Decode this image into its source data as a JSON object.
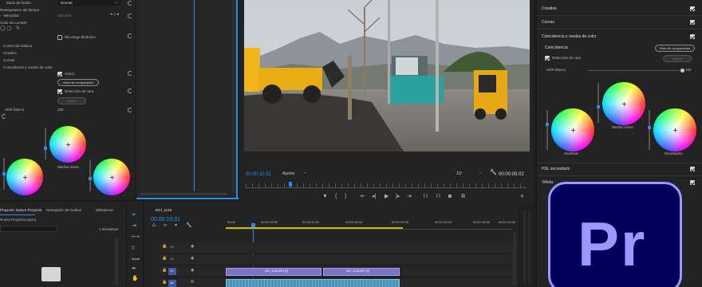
{
  "effect_controls": {
    "blend_mode_label": "Modo de fusión",
    "blend_mode_value": "Normal",
    "time_remap_label": "Reasignación del tiempo",
    "speed_label": "Velocidad",
    "speed_value": "100,00%",
    "lumetri_label": "Color de Lumetri",
    "hdr_range_label": "Alto rango dinámico",
    "basic_correction": "Corrección básica",
    "creative": "Creativo",
    "curves": "Curvas",
    "color_wheels_match": "Coincidencia y ruedas de color",
    "active_label": "Activo",
    "compare_view_button": "Vista de comparación",
    "face_detect_label": "Detección de cara",
    "apply_button": "Aplicar",
    "hdr_white_label": "HDR blanco",
    "hdr_white_value": "100",
    "midtones_label": "Medios tonos"
  },
  "program_monitor": {
    "timecode": "00:00:10:31",
    "fit_label": "Ajustar",
    "quality": "1/2",
    "duration": "00:00:05:02"
  },
  "lumetri_panel": {
    "creative": "Creativo",
    "curves": "Curvas",
    "color_wheels_match": "Coincidencia y ruedas de color",
    "match_label": "Coincidencia",
    "compare_view_button": "Vista de comparación",
    "face_detect_label": "Detección de cara",
    "apply_button": "Aplicar",
    "hdr_white_label": "HDR blanco",
    "hdr_white_value": "100",
    "shadows_label": "Sombras",
    "midtones_label": "Medios tonos",
    "highlights_label": "Resaltados",
    "hsl_secondary": "HSL secundario",
    "vignette": "Viñeta"
  },
  "project_panel": {
    "tab_project": "Proyecto: Nuevo Proyecto",
    "tab_media_browser": "Navegador de medios",
    "tab_libraries": "Bibliotecas",
    "project_file": "Nuevo Proyecto.prproj",
    "item_count": "1 elementos"
  },
  "timeline": {
    "sequence_name": "MVI_1146",
    "timecode": "00:00:10:31",
    "ruler": [
      "00:00",
      "00:00:16:00",
      "00:00:32:00",
      "00:00:48:00",
      "00:01:04:00",
      "00:01:20:00",
      "00:01:36:00",
      "00:01:52:00"
    ],
    "tracks": [
      "V3",
      "V2",
      "V1",
      "A1"
    ],
    "clip_label_1": "MVI_1136.MP4 [V]",
    "clip_label_2": "MVI_1146.MP4 [V]"
  },
  "logo": {
    "text": "Pr",
    "bg_color": "#00005b",
    "text_color": "#9999ff"
  }
}
